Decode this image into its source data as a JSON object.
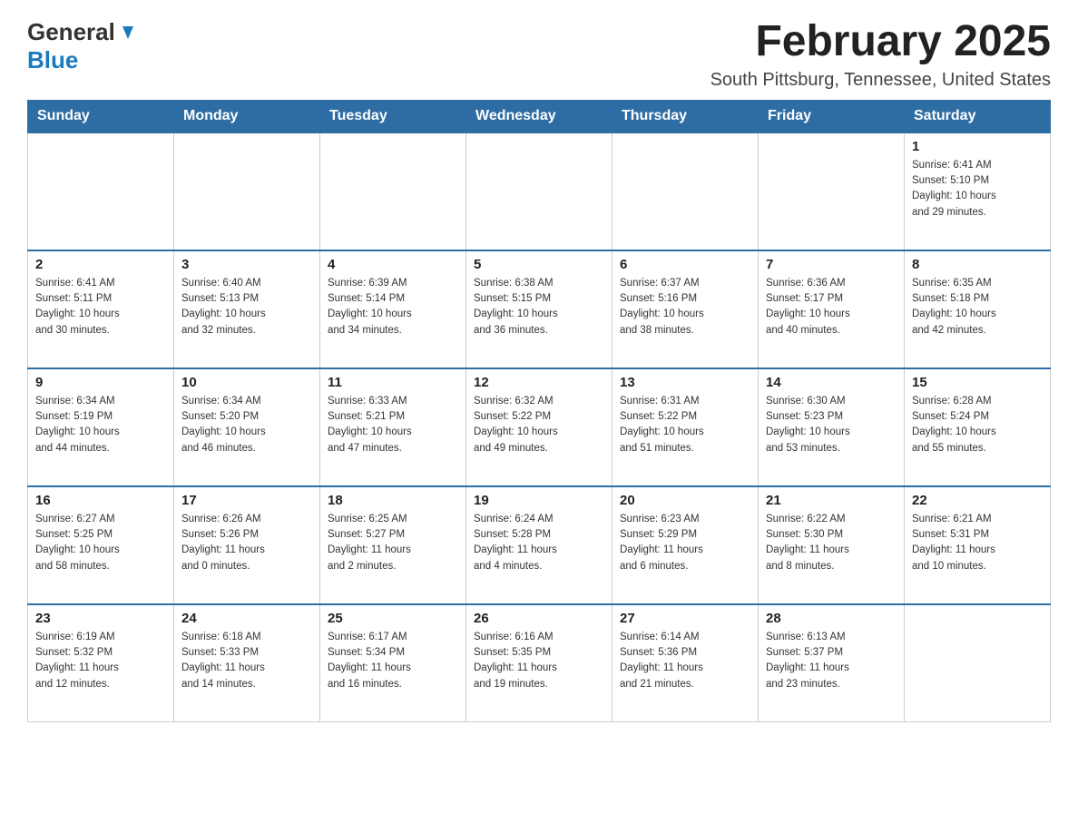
{
  "header": {
    "logo_general": "General",
    "logo_blue": "Blue",
    "title": "February 2025",
    "subtitle": "South Pittsburg, Tennessee, United States"
  },
  "days_of_week": [
    "Sunday",
    "Monday",
    "Tuesday",
    "Wednesday",
    "Thursday",
    "Friday",
    "Saturday"
  ],
  "weeks": [
    [
      {
        "day": "",
        "info": ""
      },
      {
        "day": "",
        "info": ""
      },
      {
        "day": "",
        "info": ""
      },
      {
        "day": "",
        "info": ""
      },
      {
        "day": "",
        "info": ""
      },
      {
        "day": "",
        "info": ""
      },
      {
        "day": "1",
        "info": "Sunrise: 6:41 AM\nSunset: 5:10 PM\nDaylight: 10 hours\nand 29 minutes."
      }
    ],
    [
      {
        "day": "2",
        "info": "Sunrise: 6:41 AM\nSunset: 5:11 PM\nDaylight: 10 hours\nand 30 minutes."
      },
      {
        "day": "3",
        "info": "Sunrise: 6:40 AM\nSunset: 5:13 PM\nDaylight: 10 hours\nand 32 minutes."
      },
      {
        "day": "4",
        "info": "Sunrise: 6:39 AM\nSunset: 5:14 PM\nDaylight: 10 hours\nand 34 minutes."
      },
      {
        "day": "5",
        "info": "Sunrise: 6:38 AM\nSunset: 5:15 PM\nDaylight: 10 hours\nand 36 minutes."
      },
      {
        "day": "6",
        "info": "Sunrise: 6:37 AM\nSunset: 5:16 PM\nDaylight: 10 hours\nand 38 minutes."
      },
      {
        "day": "7",
        "info": "Sunrise: 6:36 AM\nSunset: 5:17 PM\nDaylight: 10 hours\nand 40 minutes."
      },
      {
        "day": "8",
        "info": "Sunrise: 6:35 AM\nSunset: 5:18 PM\nDaylight: 10 hours\nand 42 minutes."
      }
    ],
    [
      {
        "day": "9",
        "info": "Sunrise: 6:34 AM\nSunset: 5:19 PM\nDaylight: 10 hours\nand 44 minutes."
      },
      {
        "day": "10",
        "info": "Sunrise: 6:34 AM\nSunset: 5:20 PM\nDaylight: 10 hours\nand 46 minutes."
      },
      {
        "day": "11",
        "info": "Sunrise: 6:33 AM\nSunset: 5:21 PM\nDaylight: 10 hours\nand 47 minutes."
      },
      {
        "day": "12",
        "info": "Sunrise: 6:32 AM\nSunset: 5:22 PM\nDaylight: 10 hours\nand 49 minutes."
      },
      {
        "day": "13",
        "info": "Sunrise: 6:31 AM\nSunset: 5:22 PM\nDaylight: 10 hours\nand 51 minutes."
      },
      {
        "day": "14",
        "info": "Sunrise: 6:30 AM\nSunset: 5:23 PM\nDaylight: 10 hours\nand 53 minutes."
      },
      {
        "day": "15",
        "info": "Sunrise: 6:28 AM\nSunset: 5:24 PM\nDaylight: 10 hours\nand 55 minutes."
      }
    ],
    [
      {
        "day": "16",
        "info": "Sunrise: 6:27 AM\nSunset: 5:25 PM\nDaylight: 10 hours\nand 58 minutes."
      },
      {
        "day": "17",
        "info": "Sunrise: 6:26 AM\nSunset: 5:26 PM\nDaylight: 11 hours\nand 0 minutes."
      },
      {
        "day": "18",
        "info": "Sunrise: 6:25 AM\nSunset: 5:27 PM\nDaylight: 11 hours\nand 2 minutes."
      },
      {
        "day": "19",
        "info": "Sunrise: 6:24 AM\nSunset: 5:28 PM\nDaylight: 11 hours\nand 4 minutes."
      },
      {
        "day": "20",
        "info": "Sunrise: 6:23 AM\nSunset: 5:29 PM\nDaylight: 11 hours\nand 6 minutes."
      },
      {
        "day": "21",
        "info": "Sunrise: 6:22 AM\nSunset: 5:30 PM\nDaylight: 11 hours\nand 8 minutes."
      },
      {
        "day": "22",
        "info": "Sunrise: 6:21 AM\nSunset: 5:31 PM\nDaylight: 11 hours\nand 10 minutes."
      }
    ],
    [
      {
        "day": "23",
        "info": "Sunrise: 6:19 AM\nSunset: 5:32 PM\nDaylight: 11 hours\nand 12 minutes."
      },
      {
        "day": "24",
        "info": "Sunrise: 6:18 AM\nSunset: 5:33 PM\nDaylight: 11 hours\nand 14 minutes."
      },
      {
        "day": "25",
        "info": "Sunrise: 6:17 AM\nSunset: 5:34 PM\nDaylight: 11 hours\nand 16 minutes."
      },
      {
        "day": "26",
        "info": "Sunrise: 6:16 AM\nSunset: 5:35 PM\nDaylight: 11 hours\nand 19 minutes."
      },
      {
        "day": "27",
        "info": "Sunrise: 6:14 AM\nSunset: 5:36 PM\nDaylight: 11 hours\nand 21 minutes."
      },
      {
        "day": "28",
        "info": "Sunrise: 6:13 AM\nSunset: 5:37 PM\nDaylight: 11 hours\nand 23 minutes."
      },
      {
        "day": "",
        "info": ""
      }
    ]
  ]
}
